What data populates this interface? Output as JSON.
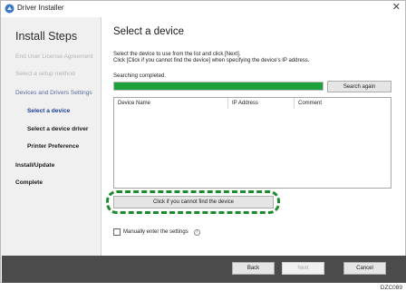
{
  "window": {
    "title": "Driver Installer",
    "close_glyph": "✕",
    "app_icon": "driver-installer-icon"
  },
  "sidebar": {
    "title": "Install Steps",
    "items": [
      {
        "label": "End User License Agreement",
        "state": "done"
      },
      {
        "label": "Select a setup method",
        "state": "done"
      },
      {
        "label": "Devices and Drivers Settings",
        "state": "group"
      },
      {
        "label": "Select a device",
        "state": "current"
      },
      {
        "label": "Select a device driver",
        "state": "pending"
      },
      {
        "label": "Printer Preference",
        "state": "pending"
      },
      {
        "label": "Install/Update",
        "state": "pending"
      },
      {
        "label": "Complete",
        "state": "pending"
      }
    ]
  },
  "main": {
    "title": "Select a device",
    "instructions": [
      "Select the device to use from the list and click [Next].",
      "Click [Click if you cannot find the device] when specifying the device's IP address."
    ],
    "status": "Searching completed.",
    "progress_percent": 100,
    "search_again_label": "Search again",
    "table": {
      "columns": [
        "Device Name",
        "IP Address",
        "Comment"
      ],
      "rows": []
    },
    "cannot_find_label": "Click if you cannot find the device",
    "manual_label": "Manually enter the settings",
    "manual_checked": false,
    "info_glyph": "i"
  },
  "footer": {
    "back_label": "Back",
    "next_label": "Next",
    "cancel_label": "Cancel",
    "next_enabled": false
  },
  "figure_code": "DZC089",
  "colors": {
    "progress_fill": "#1ea03c",
    "highlight": "#1e8a2e",
    "current_step": "#1d3f9a",
    "bottom_bar": "#4b4b4b"
  }
}
